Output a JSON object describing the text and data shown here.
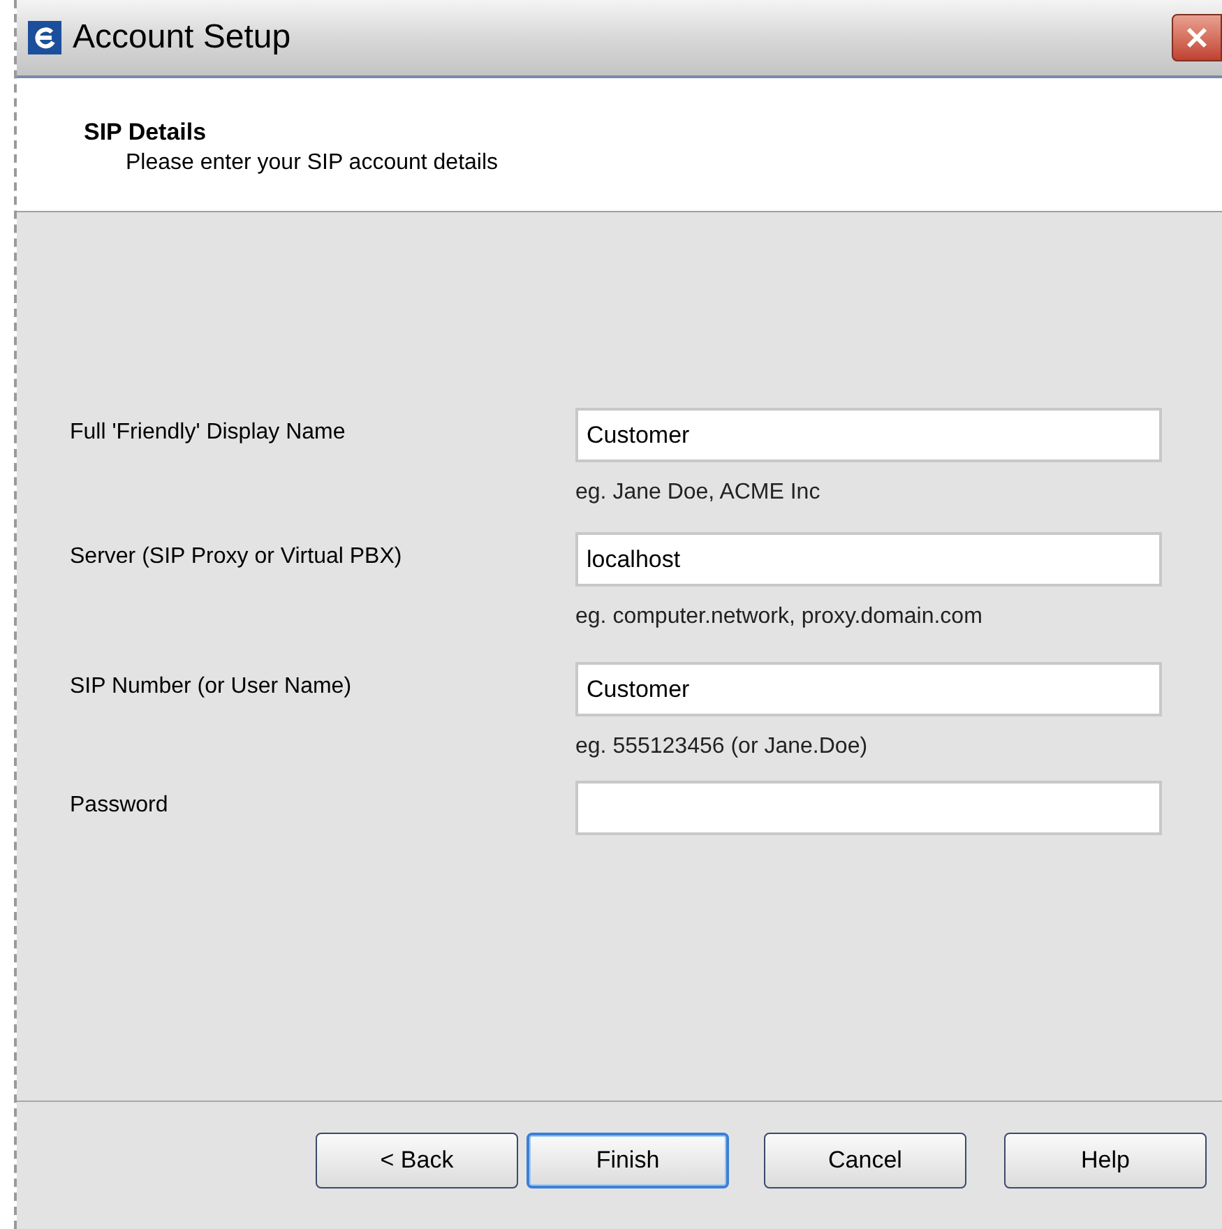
{
  "window": {
    "title": "Account Setup"
  },
  "header": {
    "title": "SIP Details",
    "subtitle": "Please enter your SIP account details"
  },
  "fields": [
    {
      "label": "Full 'Friendly' Display Name",
      "value": "Customer",
      "hint": "eg. Jane Doe, ACME Inc"
    },
    {
      "label": "Server (SIP Proxy or Virtual PBX)",
      "value": "localhost",
      "hint": "eg. computer.network, proxy.domain.com"
    },
    {
      "label": "SIP Number (or User Name)",
      "value": "Customer",
      "hint": "eg. 555123456 (or Jane.Doe)"
    },
    {
      "label": "Password"
    }
  ],
  "buttons": [
    {
      "label": "< Back",
      "focused": false
    },
    {
      "label": "Finish",
      "focused": true
    },
    {
      "label": "Cancel",
      "focused": false
    },
    {
      "label": "Help",
      "focused": false
    }
  ]
}
